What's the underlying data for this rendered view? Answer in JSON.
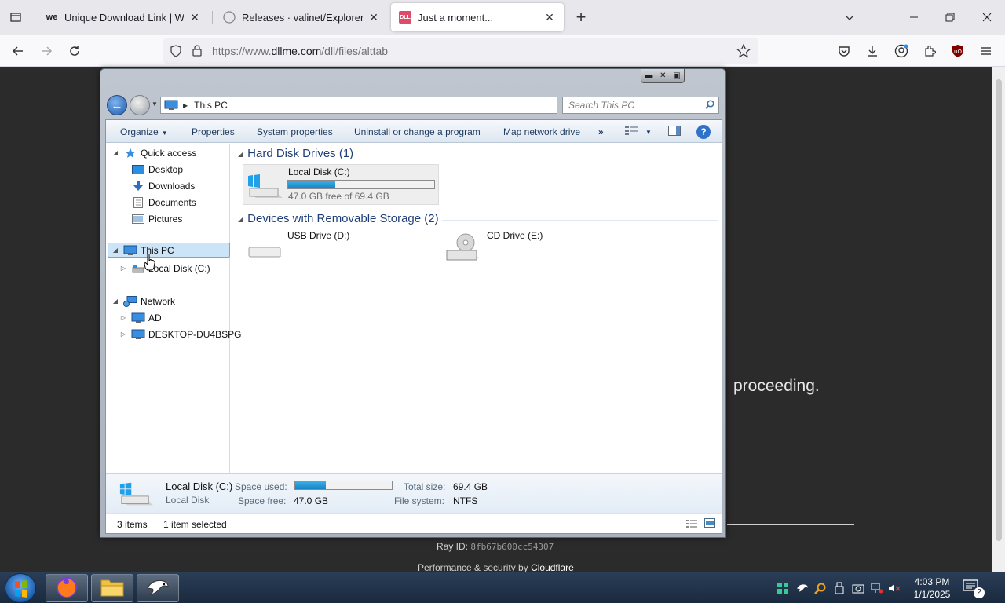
{
  "browser": {
    "tabs": [
      {
        "title": "Unique Download Link | WeTransfer",
        "favicon": "we"
      },
      {
        "title": "Releases · valinet/ExplorerPatcher",
        "favicon": "github"
      },
      {
        "title": "Just a moment...",
        "favicon": "DLL"
      }
    ],
    "url_prefix": "https://www.",
    "url_domain": "dllme.com",
    "url_path": "/dll/files/alttab"
  },
  "page": {
    "proceed_text": "proceeding.",
    "ray_label": "Ray ID: ",
    "ray_id": "8fb67b600cc54307",
    "perf_text": "Performance & security by ",
    "perf_brand": "Cloudflare"
  },
  "explorer": {
    "address": "This PC",
    "search_placeholder": "Search This PC",
    "commands": {
      "organize": "Organize",
      "properties": "Properties",
      "system_properties": "System properties",
      "uninstall": "Uninstall or change a program",
      "map_drive": "Map network drive",
      "more": "»"
    },
    "nav": {
      "quick_access": "Quick access",
      "desktop": "Desktop",
      "downloads": "Downloads",
      "documents": "Documents",
      "pictures": "Pictures",
      "this_pc": "This PC",
      "local_disk": "Local Disk (C:)",
      "network": "Network",
      "ad": "AD",
      "desktop_pc": "DESKTOP-DU4BSPG"
    },
    "groups": {
      "hdd": "Hard Disk Drives (1)",
      "removable": "Devices with Removable Storage (2)"
    },
    "drives": {
      "c_name": "Local Disk (C:)",
      "c_free": "47.0 GB free of 69.4 GB",
      "c_used_fraction": 0.32,
      "usb_name": "USB Drive (D:)",
      "cd_name": "CD Drive (E:)"
    },
    "details": {
      "name": "Local Disk (C:)",
      "type": "Local Disk",
      "space_used_label": "Space used:",
      "space_free_label": "Space free:",
      "space_free": "47.0 GB",
      "total_size_label": "Total size:",
      "total_size": "69.4 GB",
      "file_system_label": "File system:",
      "file_system": "NTFS"
    },
    "status": {
      "items": "3 items",
      "selected": "1 item selected"
    }
  },
  "taskbar": {
    "time": "4:03 PM",
    "date": "1/1/2025",
    "notifications": "2"
  },
  "colors": {
    "accent": "#1783c4",
    "header_blue": "#1e3e7a",
    "page_bg": "#2b2b2b"
  }
}
